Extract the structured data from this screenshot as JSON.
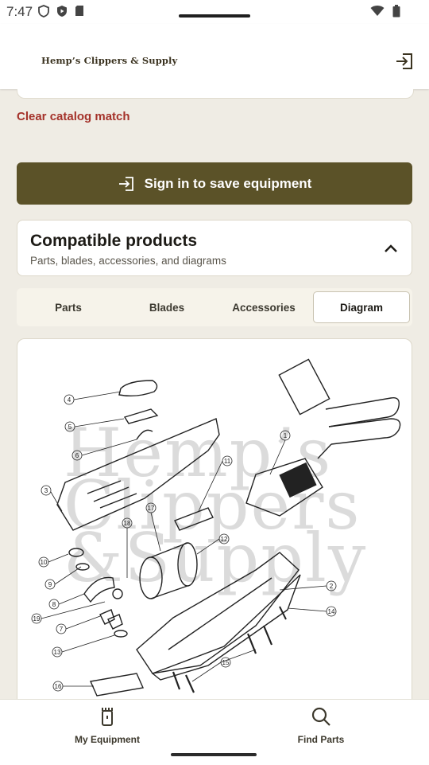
{
  "status_bar": {
    "time": "7:47"
  },
  "header": {
    "brand": "Hemp’s Clippers & Supply",
    "logout_icon": "logout-icon"
  },
  "catalog": {
    "clear_label": "Clear catalog match"
  },
  "signin": {
    "label": "Sign in to save equipment",
    "icon": "login-icon"
  },
  "compatible": {
    "title": "Compatible products",
    "subtitle": "Parts, blades, accessories, and diagrams",
    "toggle_icon": "chevron-up-icon"
  },
  "tabs": [
    {
      "label": "Parts",
      "active": false
    },
    {
      "label": "Blades",
      "active": false
    },
    {
      "label": "Accessories",
      "active": false
    },
    {
      "label": "Diagram",
      "active": true
    }
  ],
  "diagram": {
    "watermark": [
      "Hemp’s",
      "Clippers",
      "&Supply"
    ],
    "callouts": [
      "1",
      "2",
      "3",
      "4",
      "5",
      "6",
      "7",
      "8",
      "9",
      "10",
      "11",
      "12",
      "13",
      "14",
      "15",
      "16",
      "17",
      "18",
      "19"
    ]
  },
  "bottom_nav": [
    {
      "label": "My Equipment",
      "icon": "clipper-icon"
    },
    {
      "label": "Find Parts",
      "icon": "search-icon"
    }
  ],
  "colors": {
    "accent": "#5b5228",
    "link": "#a4322a",
    "background": "#efece4"
  }
}
